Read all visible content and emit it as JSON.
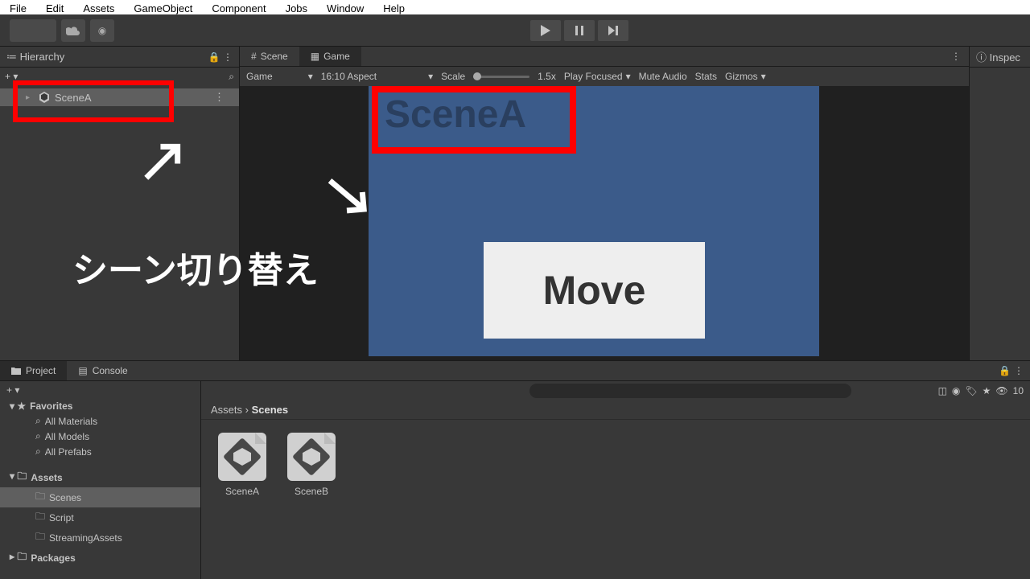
{
  "menubar": [
    "File",
    "Edit",
    "Assets",
    "GameObject",
    "Component",
    "Jobs",
    "Window",
    "Help"
  ],
  "hierarchy": {
    "title": "Hierarchy",
    "scene": "SceneA"
  },
  "tabs": {
    "scene": "Scene",
    "game": "Game"
  },
  "gameToolbar": {
    "mode": "Game",
    "aspect": "16:10 Aspect",
    "scale_label": "Scale",
    "scale_value": "1.5x",
    "play_mode": "Play Focused",
    "mute": "Mute Audio",
    "stats": "Stats",
    "gizmos": "Gizmos"
  },
  "gameView": {
    "scene_title": "SceneA",
    "button_label": "Move"
  },
  "annotation": "シーン切り替え",
  "inspector": {
    "title": "Inspec"
  },
  "project": {
    "tab_project": "Project",
    "tab_console": "Console",
    "hidden_count": "10",
    "favorites": "Favorites",
    "fav_items": [
      "All Materials",
      "All Models",
      "All Prefabs"
    ],
    "assets": "Assets",
    "asset_folders": [
      "Scenes",
      "Script",
      "StreamingAssets"
    ],
    "packages": "Packages",
    "breadcrumb_root": "Assets",
    "breadcrumb_current": "Scenes",
    "scenes": [
      "SceneA",
      "SceneB"
    ]
  }
}
